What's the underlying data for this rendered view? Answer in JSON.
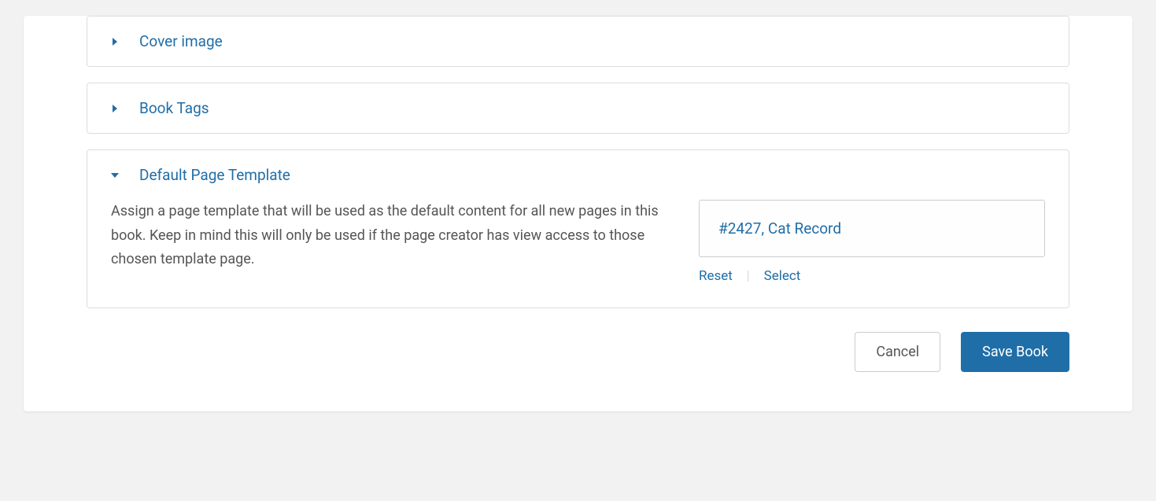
{
  "panels": {
    "cover_image": {
      "title": "Cover image"
    },
    "book_tags": {
      "title": "Book Tags"
    },
    "default_template": {
      "title": "Default Page Template",
      "description": "Assign a page template that will be used as the default content for all new pages in this book. Keep in mind this will only be used if the page creator has view access to those chosen template page.",
      "selected": "#2427, Cat Record",
      "reset_label": "Reset",
      "select_label": "Select"
    }
  },
  "buttons": {
    "cancel": "Cancel",
    "save": "Save Book"
  }
}
